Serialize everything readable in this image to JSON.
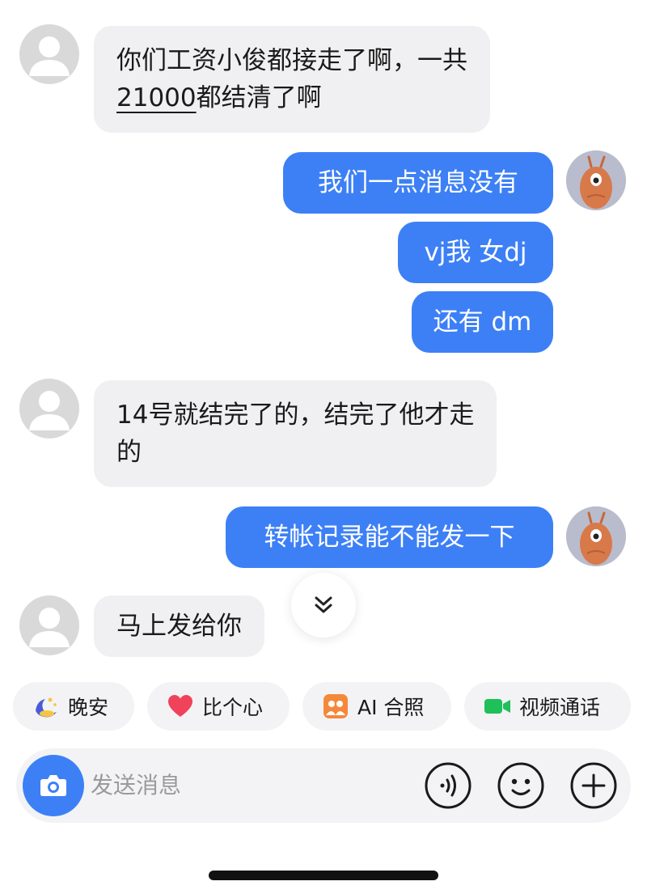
{
  "messages": {
    "m1": {
      "line1": "你们工资小俊都接走了啊，一共",
      "amount": "21000",
      "line2_rest": "都结清了啊"
    },
    "m2": {
      "text": "我们一点消息没有"
    },
    "m3": {
      "text": "vj我 女dj"
    },
    "m4": {
      "text": "还有 dm"
    },
    "m5": {
      "line1": "14号就结完了的，结完了他才走",
      "line2": "的"
    },
    "m6": {
      "text": "转帐记录能不能发一下"
    },
    "m7": {
      "text": "马上发给你"
    }
  },
  "quick_replies": [
    {
      "label": "晚安",
      "icon": "moon-night-icon"
    },
    {
      "label": "比个心",
      "icon": "heart-icon"
    },
    {
      "label": "AI 合照",
      "icon": "ai-photo-icon"
    },
    {
      "label": "视频通话",
      "icon": "video-camera-icon"
    }
  ],
  "input": {
    "placeholder": "发送消息"
  },
  "colors": {
    "self_bubble": "#3d80f6",
    "other_bubble": "#f0f0f2",
    "heart": "#f0425a",
    "video": "#1fbf5a",
    "ai_photo": "#f5883a"
  }
}
